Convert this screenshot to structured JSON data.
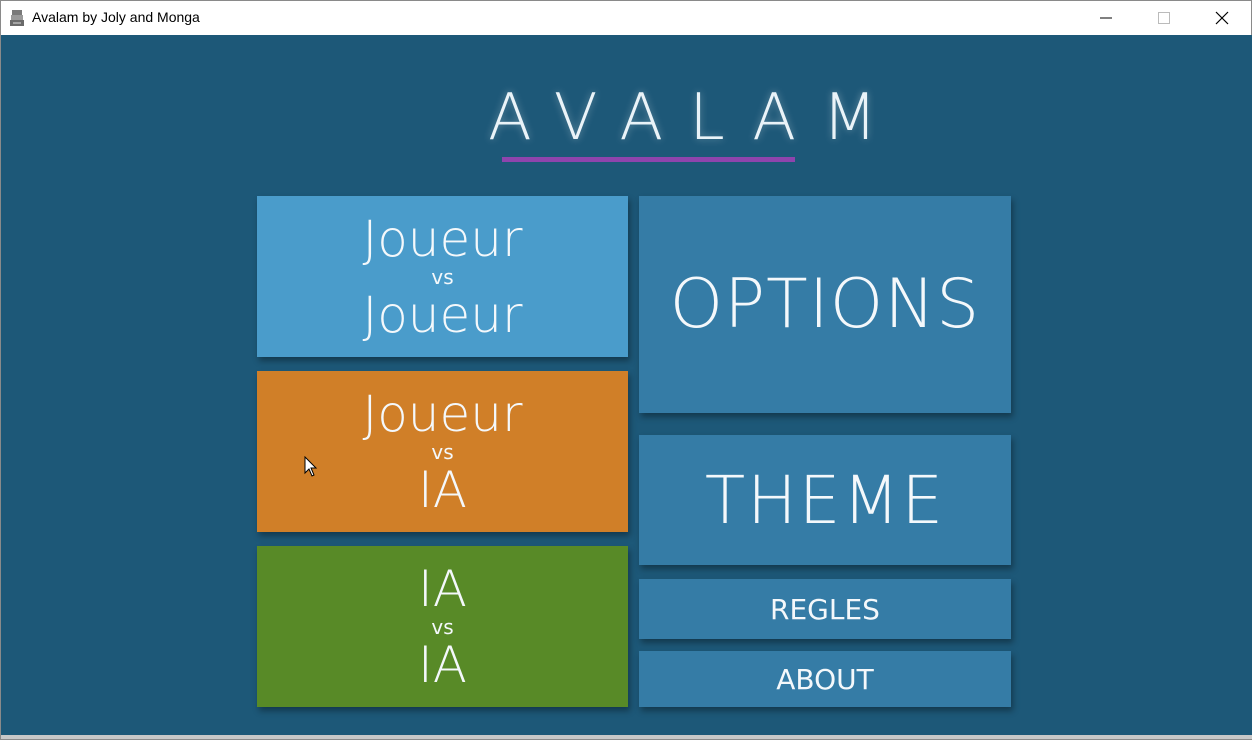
{
  "window": {
    "title": "Avalam by Joly and Monga",
    "controls": [
      "minimize",
      "maximize",
      "close"
    ]
  },
  "logo": {
    "text": "AVALAM",
    "underline_color": "#8e44ad"
  },
  "menu": {
    "pvp": {
      "line1": "Joueur",
      "vs": "vs",
      "line2": "Joueur",
      "color": "#4a9ccb"
    },
    "pve": {
      "line1": "Joueur",
      "vs": "vs",
      "line2": "IA",
      "color": "#d07f28"
    },
    "eve": {
      "line1": "IA",
      "vs": "vs",
      "line2": "IA",
      "color": "#588a27"
    },
    "options": {
      "label": "OPTIONS",
      "color": "#357ca6"
    },
    "theme": {
      "label": "THEME",
      "color": "#357ca6"
    },
    "rules": {
      "label": "REGLES",
      "color": "#357ca6"
    },
    "about": {
      "label": "ABOUT",
      "color": "#357ca6"
    }
  },
  "background_color": "#1d5878"
}
